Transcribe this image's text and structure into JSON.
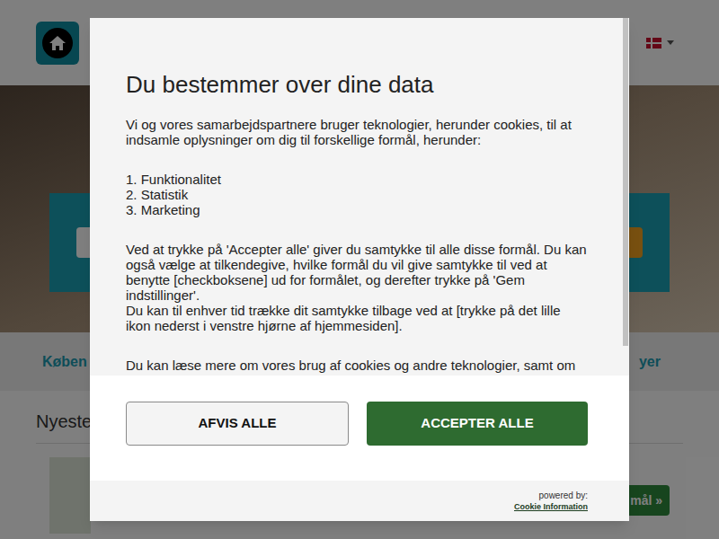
{
  "page": {
    "nav_left": "Køben",
    "nav_right": "yer",
    "heading": "Nyeste",
    "cta": "mål »"
  },
  "dialog": {
    "title": "Du bestemmer over dine data",
    "intro": "Vi og vores samarbejdspartnere bruger teknologier, herunder cookies, til at indsamle oplysninger om dig til forskellige formål, herunder:",
    "purposes": [
      "1. Funktionalitet",
      "2. Statistik",
      "3. Marketing"
    ],
    "consent_lines": [
      "Ved at trykke på 'Accepter alle' giver du samtykke til alle disse formål. Du kan også vælge at tilkendegive, hvilke formål du vil give samtykke til ved at benytte [checkboksene] ud for formålet, og derefter trykke på 'Gem indstillinger'.",
      "Du kan til enhver tid trække dit samtykke tilbage ved at [trykke på det lille ikon nederst i venstre hjørne af hjemmesiden]."
    ],
    "more": "Du kan læse mere om vores brug af cookies og andre teknologier, samt om",
    "buttons": [
      {
        "label": "AFVIS ALLE",
        "primary": false
      },
      {
        "label": "ACCEPTER ALLE",
        "primary": true
      }
    ],
    "powered_by": "powered by:",
    "provider": "Cookie Information"
  }
}
